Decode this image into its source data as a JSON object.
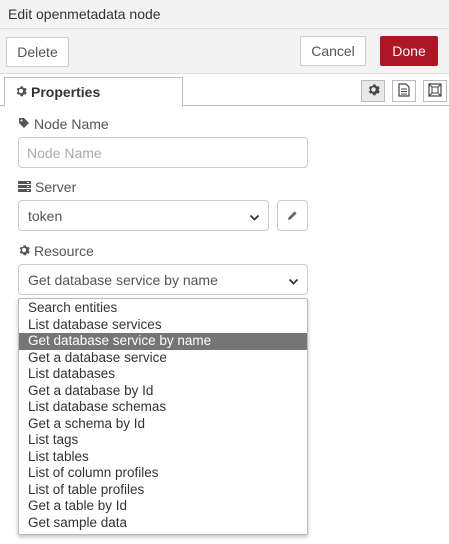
{
  "window": {
    "title": "Edit openmetadata node"
  },
  "toolbar": {
    "delete_label": "Delete",
    "cancel_label": "Cancel",
    "done_label": "Done",
    "done_color": "#ad1625"
  },
  "tabs": {
    "properties_label": "Properties"
  },
  "form": {
    "node_name_label": "Node Name",
    "node_name_placeholder": "Node Name",
    "node_name_value": "",
    "server_label": "Server",
    "server_value": "token",
    "resource_label": "Resource",
    "resource_value": "Get database service by name"
  },
  "resource_options": [
    "Search entities",
    "List database services",
    "Get database service by name",
    "Get a database service",
    "List databases",
    "Get a database by Id",
    "List database schemas",
    "Get a schema by Id",
    "List tags",
    "List tables",
    "List of column profiles",
    "List of table profiles",
    "Get a table by Id",
    "Get sample data"
  ],
  "selected_option_index": 2,
  "icons": [
    "gear-icon",
    "description-icon",
    "appearance-icon",
    "tag-icon",
    "server-icon",
    "pencil-icon",
    "chevron-down-icon"
  ]
}
